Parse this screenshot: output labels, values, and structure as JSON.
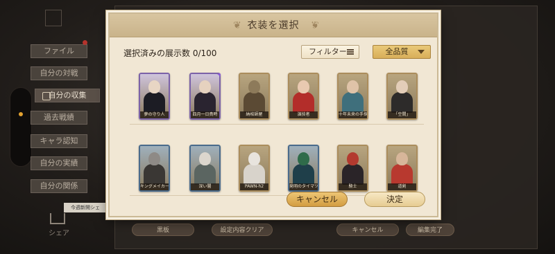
{
  "background": {
    "sidebar": [
      {
        "label": "ファイル"
      },
      {
        "label": "自分の対戦"
      },
      {
        "label": "自分の収集",
        "active": true
      },
      {
        "label": "過去戦績"
      },
      {
        "label": "キャラ認知"
      },
      {
        "label": "自分の実績"
      },
      {
        "label": "自分の関係"
      }
    ],
    "share_tooltip": "今週新開シェ",
    "share_label": "シェア",
    "bottom_buttons": [
      {
        "label": "黒板"
      },
      {
        "label": "設定内容クリア"
      },
      {
        "label": "キャンセル"
      },
      {
        "label": "編集完了"
      }
    ]
  },
  "modal": {
    "title": "衣装を選択",
    "count_label": "選択済みの展示数 0/100",
    "filter_label": "フィルター",
    "filter_icon": "list-icon",
    "quality_select": "全品質",
    "cancel_label": "キャンセル",
    "ok_label": "決定"
  },
  "costumes": [
    {
      "name": "夢の守り人",
      "frame": "purple",
      "skin": "#e8d6c4",
      "outfit": "#1c1c24"
    },
    {
      "name": "四月一日貴時",
      "frame": "purple",
      "skin": "#e6d2bf",
      "outfit": "#2a2430",
      "badge": "star-badge-icon"
    },
    {
      "name": "納棺師屋",
      "frame": "gold",
      "skin": "#8d7a5a",
      "outfit": "#5b4a34"
    },
    {
      "name": "演技者",
      "frame": "gold",
      "skin": "#e9c9b0",
      "outfit": "#b32d2a"
    },
    {
      "name": "十年未来の手探士",
      "frame": "gold",
      "skin": "#dfc3a8",
      "outfit": "#3f6f7c"
    },
    {
      "name": "「空間」",
      "frame": "gold",
      "skin": "#e3cdb8",
      "outfit": "#2d2b2a"
    },
    {
      "name": "キングメイカーウ",
      "frame": "blue",
      "skin": "#8e8a86",
      "outfit": "#3a3734"
    },
    {
      "name": "深い闇",
      "frame": "blue",
      "skin": "#dcd6cd",
      "outfit": "#5b6561"
    },
    {
      "name": "PAWN-h2",
      "frame": "gold",
      "skin": "#e8e4de",
      "outfit": "#d8d3cb"
    },
    {
      "name": "発明のタイマツ",
      "frame": "blue",
      "skin": "#2f6b4a",
      "outfit": "#1f3f4a"
    },
    {
      "name": "騎士",
      "frame": "gold",
      "skin": "#b33a2f",
      "outfit": "#2a2428"
    },
    {
      "name": "道剣",
      "frame": "gold",
      "skin": "#d7b69a",
      "outfit": "#b8392f"
    }
  ]
}
